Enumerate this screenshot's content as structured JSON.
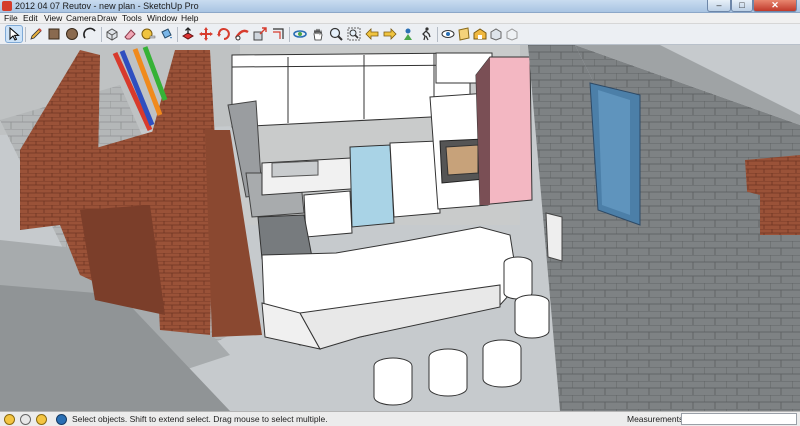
{
  "window": {
    "title": "2012 04 07 Reutov - new plan - SketchUp Pro",
    "minimize_glyph": "–",
    "maximize_glyph": "□",
    "close_glyph": "✕"
  },
  "menu": {
    "items": [
      "File",
      "Edit",
      "View",
      "Camera",
      "Draw",
      "Tools",
      "Window",
      "Help"
    ]
  },
  "toolbar": {
    "tools": [
      {
        "icon": "select-arrow-icon",
        "active": true
      },
      {
        "icon": "pencil-icon"
      },
      {
        "icon": "rectangle-icon"
      },
      {
        "icon": "circle-icon"
      },
      {
        "icon": "arc-icon"
      },
      {
        "icon": "make-component-icon"
      },
      {
        "icon": "eraser-icon"
      },
      {
        "icon": "tape-measure-icon"
      },
      {
        "icon": "paint-bucket-icon"
      },
      {
        "icon": "push-pull-icon"
      },
      {
        "icon": "move-icon"
      },
      {
        "icon": "rotate-icon"
      },
      {
        "icon": "follow-me-icon"
      },
      {
        "icon": "scale-icon"
      },
      {
        "icon": "offset-icon"
      },
      {
        "icon": "orbit-icon"
      },
      {
        "icon": "pan-icon"
      },
      {
        "icon": "zoom-icon"
      },
      {
        "icon": "zoom-extents-icon"
      },
      {
        "icon": "previous-view-icon"
      },
      {
        "icon": "next-view-icon"
      },
      {
        "icon": "position-camera-icon"
      },
      {
        "icon": "walk-icon"
      },
      {
        "icon": "look-around-icon"
      },
      {
        "icon": "section-plane-icon"
      },
      {
        "icon": "warehouse-icon"
      },
      {
        "icon": "share-model-icon"
      },
      {
        "icon": "get-models-icon"
      }
    ]
  },
  "viewport": {
    "scene": "3d-kitchen-model",
    "colors": {
      "brick": "#9a5238",
      "concrete_wall": "#7c7f80",
      "floor": "#c4c9cd",
      "cabinet": "#ffffff",
      "fridge": "#f3b7c2",
      "dishwasher": "#a9d3e6",
      "window_glass": "#4c7fa8"
    }
  },
  "status": {
    "message": "Select objects. Shift to extend select. Drag mouse to select multiple.",
    "measurements_label": "Measurements",
    "measurements_value": ""
  }
}
